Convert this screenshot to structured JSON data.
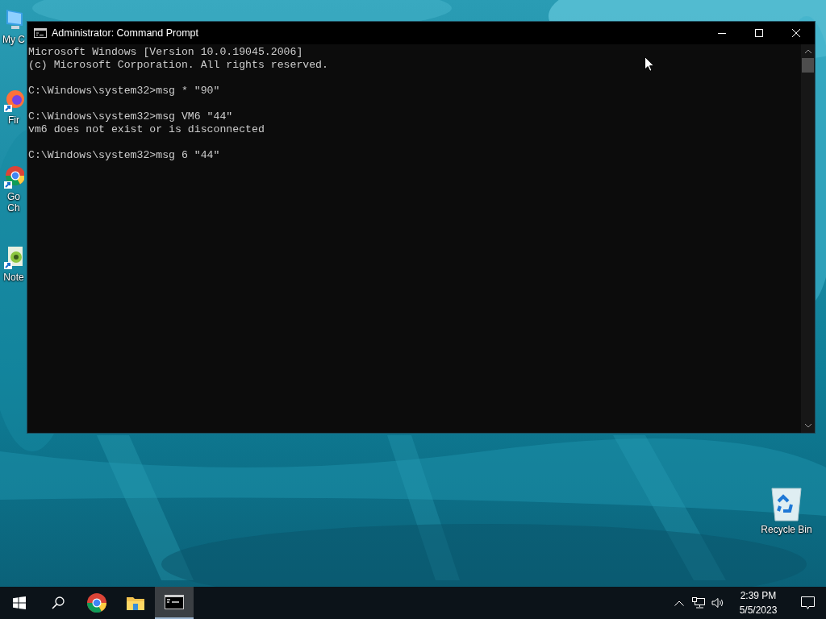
{
  "desktop_icons": [
    {
      "kind": "computer",
      "label_lines": [
        "My C"
      ]
    },
    {
      "kind": "firefox",
      "label_lines": [
        "Fir"
      ]
    },
    {
      "kind": "chrome",
      "label_lines": [
        "Go",
        "Ch"
      ]
    },
    {
      "kind": "notepad",
      "label_lines": [
        "Note"
      ]
    },
    {
      "kind": "recycle",
      "label_lines": [
        "Recycle Bin"
      ]
    }
  ],
  "window": {
    "title": "Administrator:  Command Prompt",
    "console": [
      [
        "Microsoft Windows [Version 10.0.19045.2006]",
        "(c) Microsoft Corporation. All rights reserved."
      ],
      [
        "C:\\Windows\\system32>msg * \"90\""
      ],
      [
        "C:\\Windows\\system32>msg VM6 \"44\"",
        "vm6 does not exist or is disconnected"
      ],
      [
        "C:\\Windows\\system32>msg 6 \"44\""
      ]
    ]
  },
  "taskbar": {
    "items": [
      {
        "kind": "start",
        "selected": false
      },
      {
        "kind": "search",
        "selected": false
      },
      {
        "kind": "chrome",
        "selected": false
      },
      {
        "kind": "explorer",
        "selected": false
      },
      {
        "kind": "terminal",
        "selected": true
      }
    ],
    "time": "2:39 PM",
    "date": "5/5/2023"
  }
}
